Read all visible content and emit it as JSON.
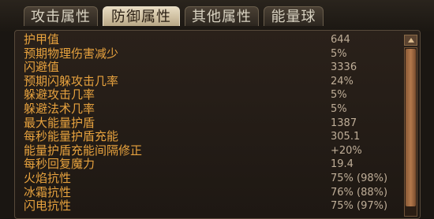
{
  "tabs": [
    {
      "label": "攻击属性"
    },
    {
      "label": "防御属性"
    },
    {
      "label": "其他属性"
    },
    {
      "label": "能量球"
    }
  ],
  "stats": [
    {
      "label": "护甲值",
      "value": "644"
    },
    {
      "label": "预期物理伤害减少",
      "value": "5%"
    },
    {
      "label": "闪避值",
      "value": "3336"
    },
    {
      "label": "预期闪躲攻击几率",
      "value": "24%"
    },
    {
      "label": "躲避攻击几率",
      "value": "5%"
    },
    {
      "label": "躲避法术几率",
      "value": "5%"
    },
    {
      "label": "最大能量护盾",
      "value": "1387"
    },
    {
      "label": "每秒能量护盾充能",
      "value": "305.1"
    },
    {
      "label": "能量护盾充能间隔修正",
      "value": "+20%"
    },
    {
      "label": "每秒回复魔力",
      "value": "19.4"
    },
    {
      "label": "火焰抗性",
      "value": "75% (98%)"
    },
    {
      "label": "冰霜抗性",
      "value": "76% (88%)"
    },
    {
      "label": "闪电抗性",
      "value": "75% (97%)"
    }
  ],
  "colors": {
    "label": "#e7a23e",
    "value": "#bfae98",
    "active_tab": "#e8dcc2"
  }
}
